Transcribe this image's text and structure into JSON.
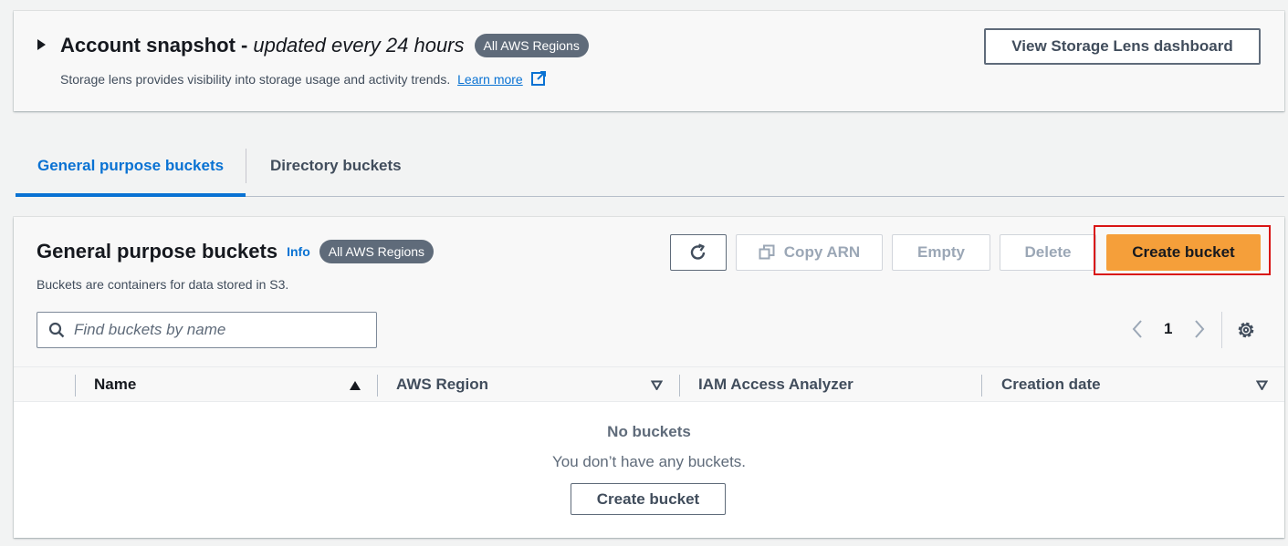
{
  "snapshot": {
    "title": "Account snapshot -",
    "subtitle": "updated every 24 hours",
    "badge": "All AWS Regions",
    "description": "Storage lens provides visibility into storage usage and activity trends.",
    "learn_more": "Learn more",
    "view_button": "View Storage Lens dashboard"
  },
  "tabs": [
    {
      "label": "General purpose buckets",
      "active": true
    },
    {
      "label": "Directory buckets",
      "active": false
    }
  ],
  "buckets": {
    "title": "General purpose buckets",
    "info": "Info",
    "badge": "All AWS Regions",
    "description": "Buckets are containers for data stored in S3.",
    "actions": {
      "copy_arn": "Copy ARN",
      "empty": "Empty",
      "delete": "Delete",
      "create": "Create bucket"
    },
    "search": {
      "placeholder": "Find buckets by name",
      "value": ""
    },
    "pagination": {
      "current_page": "1"
    },
    "columns": [
      "Name",
      "AWS Region",
      "IAM Access Analyzer",
      "Creation date"
    ],
    "empty_state": {
      "title": "No buckets",
      "description": "You don’t have any buckets.",
      "button": "Create bucket"
    }
  },
  "colors": {
    "accent": "#0972d3",
    "primary_button": "#f59f3a",
    "highlight": "#d91515",
    "badge": "#5f6b7a"
  },
  "icons": [
    "caret-right-icon",
    "external-link-icon",
    "refresh-icon",
    "copy-icon",
    "search-icon",
    "chevron-left-icon",
    "chevron-right-icon",
    "settings-icon",
    "sort-ascending-icon",
    "sort-descending-icon"
  ]
}
